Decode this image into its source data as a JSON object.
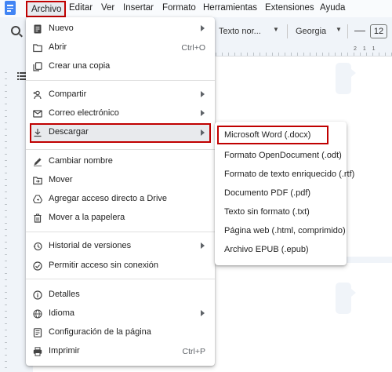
{
  "menubar": {
    "items": [
      "Archivo",
      "Editar",
      "Ver",
      "Insertar",
      "Formato",
      "Herramientas",
      "Extensiones",
      "Ayuda"
    ]
  },
  "toolbar": {
    "style_select": "Texto nor...",
    "font_select": "Georgia",
    "font_size": "12",
    "minus": "—"
  },
  "ruler": {
    "numbers": "2 1 1"
  },
  "file_menu": {
    "items": [
      {
        "label": "Nuevo",
        "icon": "document-icon",
        "submenu": true
      },
      {
        "label": "Abrir",
        "icon": "folder-icon",
        "shortcut": "Ctrl+O"
      },
      {
        "label": "Crear una copia",
        "icon": "copy-icon"
      },
      {
        "label": "Compartir",
        "icon": "person-add-icon",
        "submenu": true
      },
      {
        "label": "Correo electrónico",
        "icon": "mail-icon",
        "submenu": true
      },
      {
        "label": "Descargar",
        "icon": "download-icon",
        "submenu": true
      },
      {
        "label": "Cambiar nombre",
        "icon": "edit-icon"
      },
      {
        "label": "Mover",
        "icon": "move-folder-icon"
      },
      {
        "label": "Agregar acceso directo a Drive",
        "icon": "drive-shortcut-icon"
      },
      {
        "label": "Mover a la papelera",
        "icon": "trash-icon"
      },
      {
        "label": "Historial de versiones",
        "icon": "history-icon",
        "submenu": true
      },
      {
        "label": "Permitir acceso sin conexión",
        "icon": "offline-icon"
      },
      {
        "label": "Detalles",
        "icon": "info-icon"
      },
      {
        "label": "Idioma",
        "icon": "globe-icon",
        "submenu": true
      },
      {
        "label": "Configuración de la página",
        "icon": "page-setup-icon"
      },
      {
        "label": "Imprimir",
        "icon": "print-icon",
        "shortcut": "Ctrl+P"
      }
    ]
  },
  "download_submenu": {
    "items": [
      "Microsoft Word (.docx)",
      "Formato OpenDocument (.odt)",
      "Formato de texto enriquecido (.rtf)",
      "Documento PDF (.pdf)",
      "Texto sin formato (.txt)",
      "Página web (.html, comprimido)",
      "Archivo EPUB (.epub)"
    ]
  },
  "colors": {
    "highlight_border": "#c00000",
    "docs_blue": "#4285f4",
    "canvas": "#f0f4f9"
  }
}
